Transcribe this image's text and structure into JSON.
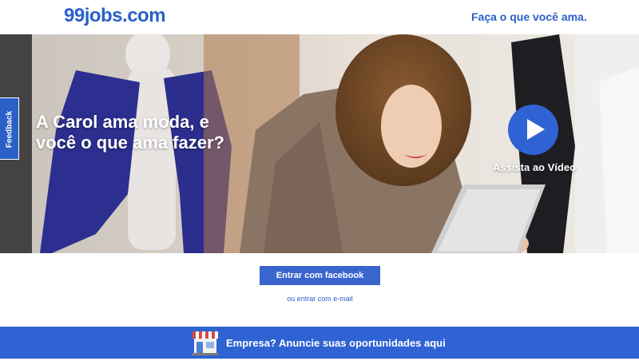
{
  "header": {
    "logo_text": "99jobs.com",
    "tagline": "Faça o que você ama."
  },
  "hero": {
    "title": "A Carol ama moda, e você o que ama fazer?",
    "video_label": "Assista ao Vídeo",
    "play_icon": "play-icon"
  },
  "feedback": {
    "label": "Feedback"
  },
  "actions": {
    "facebook_button": "Entrar com facebook",
    "email_link": "ou entrar com e-mail"
  },
  "company_bar": {
    "icon": "storefront-icon",
    "text": "Empresa? Anuncie suas oportunidades aqui"
  },
  "colors": {
    "brand_blue": "#2a60c8",
    "button_blue": "#3a65cf",
    "bar_blue": "#2f63d3"
  }
}
